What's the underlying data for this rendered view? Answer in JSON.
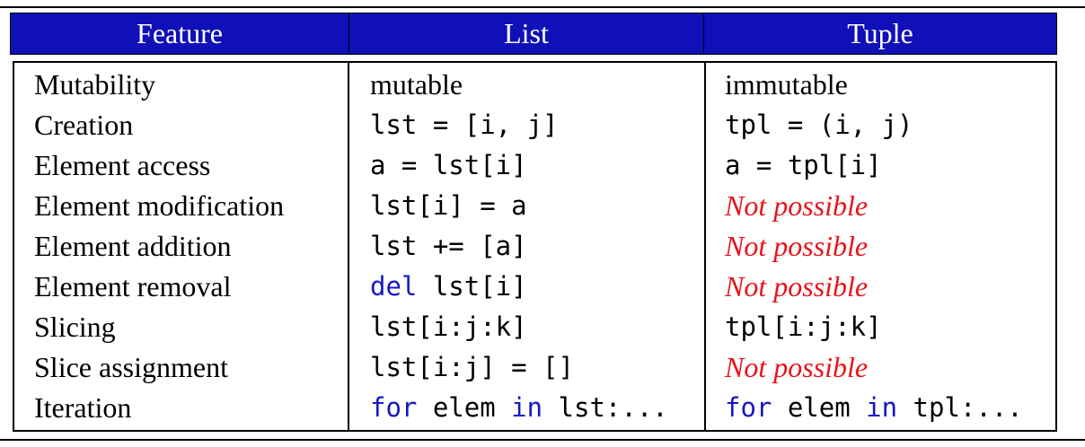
{
  "table": {
    "headers": [
      "Feature",
      "List",
      "Tuple"
    ],
    "rows": [
      {
        "feature": "Mutability",
        "list": "mutable",
        "tuple": "immutable"
      },
      {
        "feature": "Creation",
        "list": "lst = [i, j]",
        "tuple": "tpl = (i, j)"
      },
      {
        "feature": "Element access",
        "list": "a = lst[i]",
        "tuple": "a = tpl[i]"
      },
      {
        "feature": "Element modification",
        "list": "lst[i] = a",
        "tuple": "Not possible"
      },
      {
        "feature": "Element addition",
        "list": "lst += [a]",
        "tuple": "Not possible"
      },
      {
        "feature": "Element removal",
        "list_kw": "del",
        "list_rest": " lst[i]",
        "tuple": "Not possible"
      },
      {
        "feature": "Slicing",
        "list": "lst[i:j:k]",
        "tuple": "tpl[i:j:k]"
      },
      {
        "feature": "Slice assignment",
        "list": "lst[i:j] = []",
        "tuple": "Not possible"
      },
      {
        "feature": "Iteration",
        "list_kw1": "for",
        "list_mid": " elem ",
        "list_kw2": "in",
        "list_rest": " lst:...",
        "tuple_kw1": "for",
        "tuple_mid": " elem ",
        "tuple_kw2": "in",
        "tuple_rest": " tpl:..."
      }
    ]
  },
  "colors": {
    "header_bg": "#1010b8",
    "header_text": "#ffffff",
    "keyword": "#1717c6",
    "not_possible": "#e8141c"
  }
}
